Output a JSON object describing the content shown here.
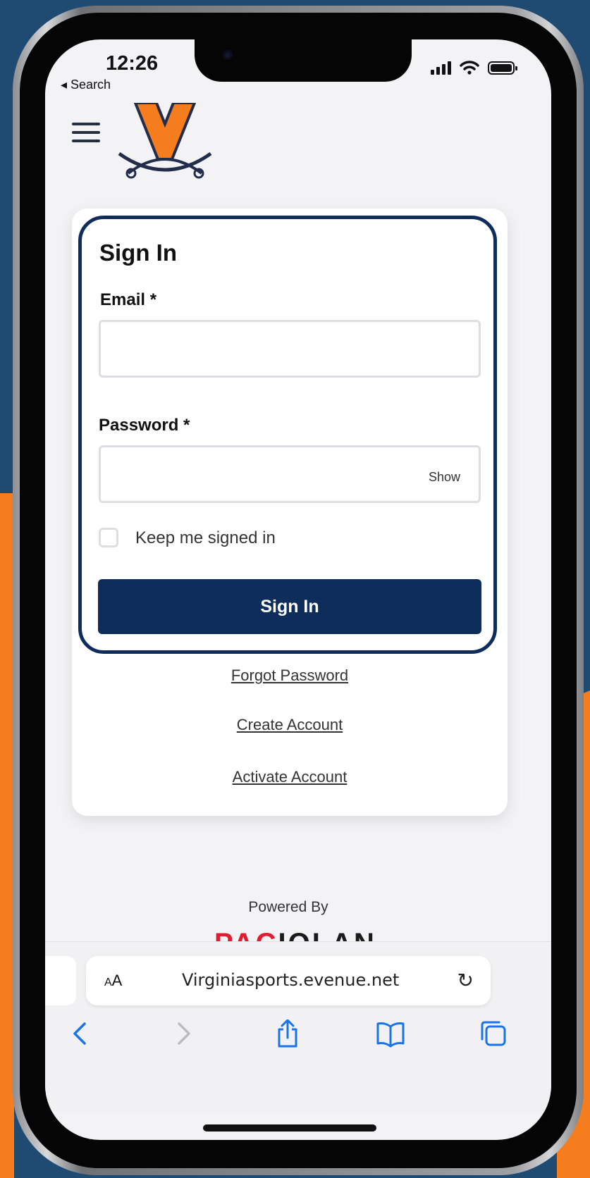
{
  "status_bar": {
    "time": "12:26",
    "back_label": "◂ Search"
  },
  "header": {
    "menu_icon": "hamburger-menu-icon",
    "logo": "virginia-v-sabres-logo"
  },
  "signin_card": {
    "title": "Sign In",
    "email_label": "Email *",
    "email_value": "",
    "password_label": "Password *",
    "password_value": "",
    "show_toggle": "Show",
    "keep_signed_in_label": "Keep me signed in",
    "keep_signed_in_checked": false,
    "submit_label": "Sign In"
  },
  "links": {
    "forgot_password": "Forgot Password",
    "create_account": "Create Account",
    "activate_account": "Activate Account"
  },
  "footer": {
    "powered_by": "Powered By",
    "brand_red": "PAC",
    "brand_dark": "IOLAN"
  },
  "browser": {
    "text_size_label": "AA",
    "url": "Virginiasports.evenue.net",
    "reload_icon": "reload-icon",
    "toolbar": [
      "back-icon",
      "forward-icon",
      "share-icon",
      "bookmarks-icon",
      "tabs-icon"
    ]
  },
  "colors": {
    "navy": "#0e2d5a",
    "orange": "#f57d1e",
    "bg_blue": "#1f4a72",
    "brand_red": "#e21b2e"
  }
}
